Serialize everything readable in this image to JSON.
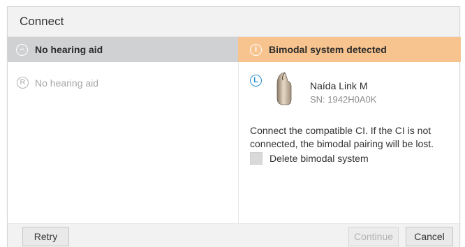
{
  "dialog": {
    "title": "Connect"
  },
  "left_panel": {
    "header_icon": "minus-circle-icon",
    "header_label": "No hearing aid",
    "side_letter": "R",
    "item_label": "No hearing aid"
  },
  "right_panel": {
    "header_icon": "info-circle-icon",
    "header_label": "Bimodal system detected",
    "side_letter": "L",
    "device_name": "Naída Link M",
    "device_serial": "SN: 1942H0A0K",
    "message": "Connect the compatible CI. If the CI is not connected, the bimodal pairing will be lost.",
    "checkbox_label": "Delete bimodal system",
    "checkbox_checked": false
  },
  "footer": {
    "retry_label": "Retry",
    "continue_label": "Continue",
    "cancel_label": "Cancel"
  },
  "colors": {
    "left_header_bg": "#cfd1d3",
    "right_header_bg": "#f7c38e",
    "left_side_accent": "#2a8fd0"
  }
}
